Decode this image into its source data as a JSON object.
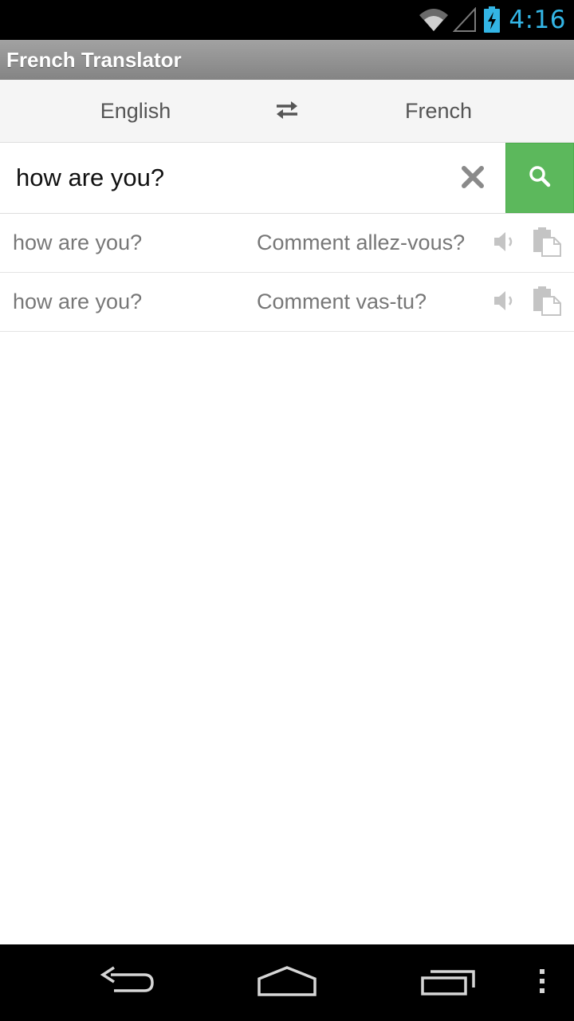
{
  "status_bar": {
    "time": "4:16",
    "icons": [
      "wifi-icon",
      "signal-icon",
      "battery-charging-icon"
    ],
    "accent_color": "#33b5e5"
  },
  "app": {
    "title": "French Translator"
  },
  "language_bar": {
    "source_language": "English",
    "target_language": "French",
    "swap_icon": "swap-arrows-icon"
  },
  "search": {
    "value": "how are you?",
    "placeholder": "",
    "clear_icon": "close-icon",
    "search_icon": "search-icon",
    "button_color": "#5cb85c"
  },
  "results": [
    {
      "source": "how are you?",
      "translation": "Comment allez-vous?",
      "speak_icon": "speaker-icon",
      "copy_icon": "copy-icon"
    },
    {
      "source": "how are you?",
      "translation": "Comment vas-tu?",
      "speak_icon": "speaker-icon",
      "copy_icon": "copy-icon"
    }
  ],
  "nav_bar": {
    "buttons": [
      "back-icon",
      "home-icon",
      "recents-icon",
      "overflow-menu-icon"
    ]
  }
}
